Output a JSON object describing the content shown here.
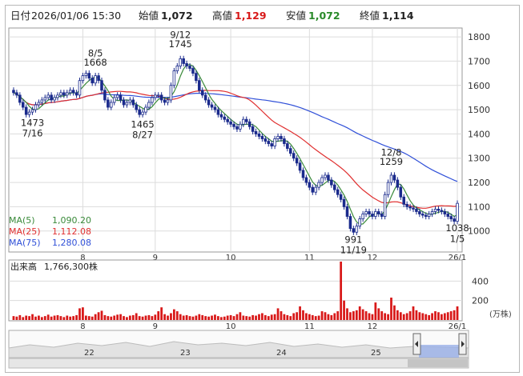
{
  "header": {
    "date_label": "日付",
    "datetime": "2026/01/06 15:30",
    "open_label": "始値",
    "open_value": "1,072",
    "high_label": "高値",
    "high_value": "1,129",
    "low_label": "安値",
    "low_value": "1,072",
    "close_label": "終値",
    "close_value": "1,114"
  },
  "legend": [
    {
      "label": "MA(5)",
      "value": "1,090.20",
      "color": "#3a8a3a"
    },
    {
      "label": "MA(25)",
      "value": "1,112.08",
      "color": "#e03030"
    },
    {
      "label": "MA(75)",
      "value": "1,280.08",
      "color": "#3050d8"
    }
  ],
  "volume_header": {
    "label": "出来高",
    "value": "1,766,300株"
  },
  "volume_unit": "(万株)",
  "colors": {
    "up": "#ffffff",
    "down": "#1a2a8c",
    "volume": "#d81818",
    "navigator": "#9ab0e8"
  },
  "annotations": [
    {
      "text": "8/5",
      "pos": "above",
      "day": 26,
      "price": 1706
    },
    {
      "text": "1668",
      "pos": "above",
      "day": 26,
      "price": 1668
    },
    {
      "text": "9/12",
      "pos": "above",
      "day": 53,
      "price": 1783
    },
    {
      "text": "1745",
      "pos": "above",
      "day": 53,
      "price": 1745
    },
    {
      "text": "1473",
      "pos": "below",
      "day": 6,
      "price": 1473
    },
    {
      "text": "7/16",
      "pos": "below",
      "day": 6,
      "price": 1430
    },
    {
      "text": "1465",
      "pos": "below",
      "day": 41,
      "price": 1465
    },
    {
      "text": "8/27",
      "pos": "below",
      "day": 41,
      "price": 1422
    },
    {
      "text": "12/8",
      "pos": "above",
      "day": 120,
      "price": 1297
    },
    {
      "text": "1259",
      "pos": "above",
      "day": 120,
      "price": 1259
    },
    {
      "text": "991",
      "pos": "below",
      "day": 108,
      "price": 991
    },
    {
      "text": "11/19",
      "pos": "below",
      "day": 108,
      "price": 948
    },
    {
      "text": "1038",
      "pos": "below",
      "day": 141,
      "price": 1038
    },
    {
      "text": "1/5",
      "pos": "below",
      "day": 141,
      "price": 995
    }
  ],
  "chart_data": {
    "type": "candlestick",
    "x_month_labels": [
      {
        "label": "8",
        "day": 22
      },
      {
        "label": "9",
        "day": 45
      },
      {
        "label": "10",
        "day": 69
      },
      {
        "label": "11",
        "day": 94
      },
      {
        "label": "12",
        "day": 114
      },
      {
        "label": "26/1",
        "day": 141
      }
    ],
    "price_axis": {
      "ticks": [
        1000,
        1100,
        1200,
        1300,
        1400,
        1500,
        1600,
        1700,
        1800
      ],
      "ylim": [
        920,
        1830
      ]
    },
    "volume_axis": {
      "ticks": [
        200,
        400
      ],
      "ylim": [
        0,
        600
      ]
    },
    "close": [
      1570,
      1560,
      1530,
      1510,
      1480,
      1490,
      1500,
      1520,
      1530,
      1540,
      1550,
      1560,
      1540,
      1550,
      1560,
      1570,
      1560,
      1570,
      1580,
      1570,
      1560,
      1620,
      1640,
      1650,
      1630,
      1610,
      1640,
      1620,
      1580,
      1540,
      1510,
      1530,
      1550,
      1560,
      1540,
      1520,
      1530,
      1540,
      1520,
      1500,
      1480,
      1490,
      1510,
      1530,
      1550,
      1560,
      1560,
      1540,
      1530,
      1540,
      1600,
      1660,
      1680,
      1710,
      1690,
      1680,
      1670,
      1650,
      1620,
      1580,
      1560,
      1540,
      1520,
      1510,
      1500,
      1480,
      1470,
      1460,
      1450,
      1440,
      1430,
      1420,
      1440,
      1460,
      1450,
      1430,
      1410,
      1400,
      1390,
      1380,
      1370,
      1360,
      1350,
      1380,
      1390,
      1380,
      1360,
      1340,
      1320,
      1300,
      1280,
      1250,
      1220,
      1200,
      1180,
      1160,
      1180,
      1200,
      1220,
      1230,
      1210,
      1190,
      1170,
      1150,
      1130,
      1100,
      1060,
      1010,
      995,
      1020,
      1050,
      1070,
      1080,
      1070,
      1060,
      1080,
      1070,
      1060,
      1150,
      1200,
      1230,
      1210,
      1180,
      1140,
      1110,
      1100,
      1095,
      1090,
      1080,
      1070,
      1065,
      1060,
      1070,
      1080,
      1090,
      1085,
      1080,
      1070,
      1060,
      1050,
      1040,
      1114
    ],
    "high_low_ref": {
      "max": 1745,
      "max_day": "9/12",
      "min": 991,
      "min_day": "11/19"
    },
    "ma5_last": 1090.2,
    "ma25_last": 1112.08,
    "ma75_last": 1280.08,
    "volume": [
      40,
      35,
      50,
      30,
      45,
      40,
      60,
      35,
      45,
      30,
      40,
      55,
      35,
      45,
      50,
      40,
      30,
      45,
      35,
      40,
      50,
      120,
      130,
      45,
      40,
      35,
      60,
      80,
      95,
      50,
      40,
      35,
      45,
      55,
      60,
      40,
      30,
      45,
      50,
      70,
      40,
      35,
      45,
      50,
      40,
      55,
      90,
      130,
      60,
      45,
      70,
      110,
      90,
      60,
      45,
      50,
      40,
      35,
      45,
      60,
      50,
      40,
      35,
      45,
      55,
      40,
      30,
      35,
      45,
      50,
      40,
      60,
      80,
      45,
      40,
      35,
      50,
      45,
      60,
      70,
      50,
      40,
      55,
      60,
      120,
      90,
      60,
      50,
      40,
      70,
      80,
      140,
      100,
      70,
      60,
      50,
      40,
      45,
      90,
      80,
      60,
      50,
      70,
      90,
      600,
      200,
      120,
      80,
      90,
      100,
      140,
      110,
      90,
      70,
      60,
      180,
      120,
      90,
      70,
      60,
      230,
      150,
      100,
      80,
      60,
      70,
      90,
      140,
      100,
      80,
      70,
      60,
      50,
      70,
      90,
      80,
      60,
      70,
      80,
      90,
      100,
      140
    ]
  }
}
